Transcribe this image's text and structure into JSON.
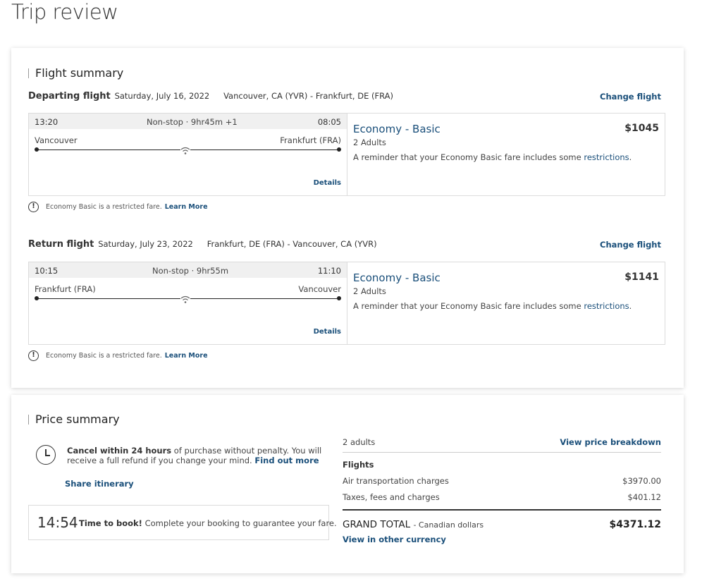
{
  "page_title": "Trip review",
  "flight_summary": {
    "title": "Flight summary",
    "change_label": "Change flight",
    "details_label": "Details",
    "restriction_text": "Economy Basic is a restricted fare.",
    "learn_more_label": "Learn More",
    "fare_note_prefix": "A reminder that your Economy Basic fare includes some",
    "fare_note_link": "restrictions",
    "flights": [
      {
        "heading": "Departing flight",
        "date": "Saturday, July 16, 2022",
        "route": "Vancouver, CA (YVR) - Frankfurt, DE (FRA)",
        "dep_time": "13:20",
        "stop_info": "Non-stop · 9hr45m +1",
        "arr_time": "08:05",
        "from": "Vancouver",
        "to": "Frankfurt (FRA)",
        "fare_name": "Economy - Basic",
        "price": "$1045",
        "passengers": "2 Adults"
      },
      {
        "heading": "Return flight",
        "date": "Saturday, July 23, 2022",
        "route": "Frankfurt, DE (FRA) - Vancouver, CA (YVR)",
        "dep_time": "10:15",
        "stop_info": "Non-stop · 9hr55m",
        "arr_time": "11:10",
        "from": "Frankfurt (FRA)",
        "to": "Vancouver",
        "fare_name": "Economy - Basic",
        "price": "$1141",
        "passengers": "2 Adults"
      }
    ]
  },
  "price_summary": {
    "title": "Price summary",
    "cancel_bold": "Cancel within 24 hours",
    "cancel_rest": "of purchase without penalty. You will receive a full refund if you change your mind.",
    "find_out_more": "Find out more",
    "share_itinerary": "Share itinerary",
    "timer_value": "14:54",
    "timer_bold": "Time to book!",
    "timer_rest": "Complete your booking to guarantee your fare.",
    "adults_label": "2 adults",
    "breakdown_label": "View price breakdown",
    "flights_label": "Flights",
    "rows": [
      {
        "label": "Air transportation charges",
        "value": "$3970.00"
      },
      {
        "label": "Taxes, fees and charges",
        "value": "$401.12"
      }
    ],
    "grand_total_label": "GRAND TOTAL",
    "grand_total_currency": "- Canadian dollars",
    "grand_total_value": "$4371.12",
    "other_currency_label": "View in other currency"
  },
  "colors": {
    "link": "#1a4f7a",
    "text": "#333333",
    "border": "#dcdcdc"
  }
}
